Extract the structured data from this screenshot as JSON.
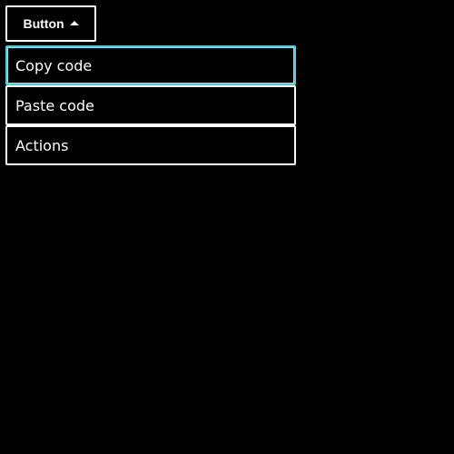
{
  "toggle": {
    "label": "Button",
    "icon": "caret-up-icon",
    "expanded": true
  },
  "menu": {
    "items": [
      {
        "label": "Copy code",
        "focused": true
      },
      {
        "label": "Paste code",
        "focused": false
      },
      {
        "label": "Actions",
        "focused": false
      }
    ]
  },
  "colors": {
    "background": "#000000",
    "border": "#ffffff",
    "focus_ring": "#56c8d8",
    "text": "#ffffff"
  }
}
